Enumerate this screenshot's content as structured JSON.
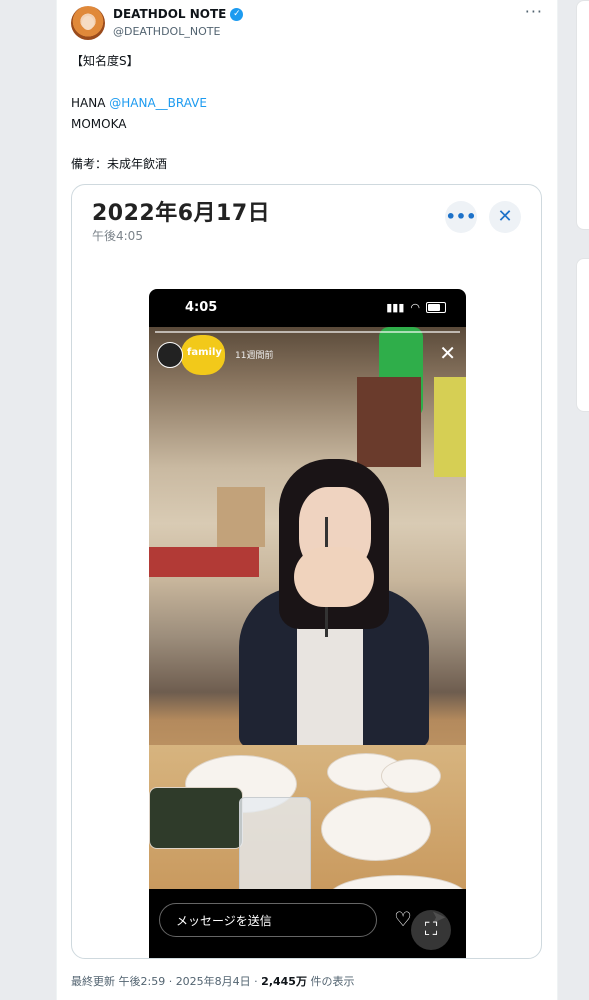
{
  "tweet": {
    "display_name": "DEATHDOL NOTE",
    "handle": "@DEATHDOL_NOTE",
    "more_icon": "more-horizontal-icon",
    "line1": "【知名度S】",
    "line2_prefix": "HANA ",
    "line2_mention": "@HANA__BRAVE",
    "line3": "MOMOKA",
    "line4": "備考：未成年飲酒"
  },
  "card": {
    "date": "2022年6月17日",
    "time": "午後4:05",
    "more_label": "•••",
    "close_label": "✕"
  },
  "story": {
    "status_time": "4:05",
    "username": "family",
    "time_ago": "11週間前",
    "close_label": "✕",
    "message_placeholder": "メッセージを送信",
    "heart_label": "♡",
    "send_label": "➤",
    "lens_label": "⛶"
  },
  "footer": {
    "prefix": "最終更新 午後2:59 · 2025年8月4日 · ",
    "views": "2,445万",
    "suffix": " 件の表示"
  },
  "colors": {
    "accent": "#1d9bf0",
    "text": "#0f1419",
    "muted": "#536471"
  }
}
